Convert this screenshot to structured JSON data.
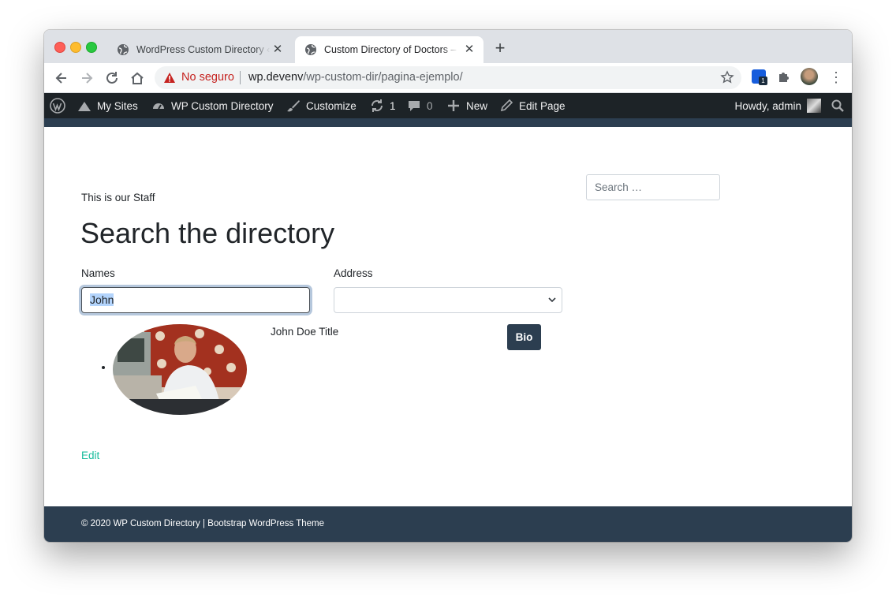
{
  "browser": {
    "tabs": [
      {
        "title": "WordPress Custom Directory ‹",
        "active": false
      },
      {
        "title": "Custom Directory of Doctors –",
        "active": true
      }
    ],
    "new_tab_label": "+",
    "security_label": "No seguro",
    "url_host": "wp.devenv",
    "url_path": "/wp-custom-dir/pagina-ejemplo/",
    "extension_badge": "1"
  },
  "adminbar": {
    "my_sites": "My Sites",
    "site_name": "WP Custom Directory",
    "customize": "Customize",
    "updates_count": "1",
    "comments_count": "0",
    "new": "New",
    "edit_page": "Edit Page",
    "howdy": "Howdy, admin"
  },
  "page": {
    "intro": "This is our Staff",
    "search_placeholder": "Search …",
    "heading": "Search the directory",
    "names_label": "Names",
    "names_value": "John",
    "address_label": "Address",
    "address_value": "",
    "person": {
      "name": "John Doe Title",
      "bio_button": "Bio"
    },
    "edit_link": "Edit"
  },
  "footer": {
    "text": "© 2020 WP Custom Directory | Bootstrap WordPress Theme"
  },
  "colors": {
    "navbar": "#2c3e50",
    "adminbar": "#1d2327",
    "link": "#18bc9c",
    "insecure": "#c5221f"
  }
}
